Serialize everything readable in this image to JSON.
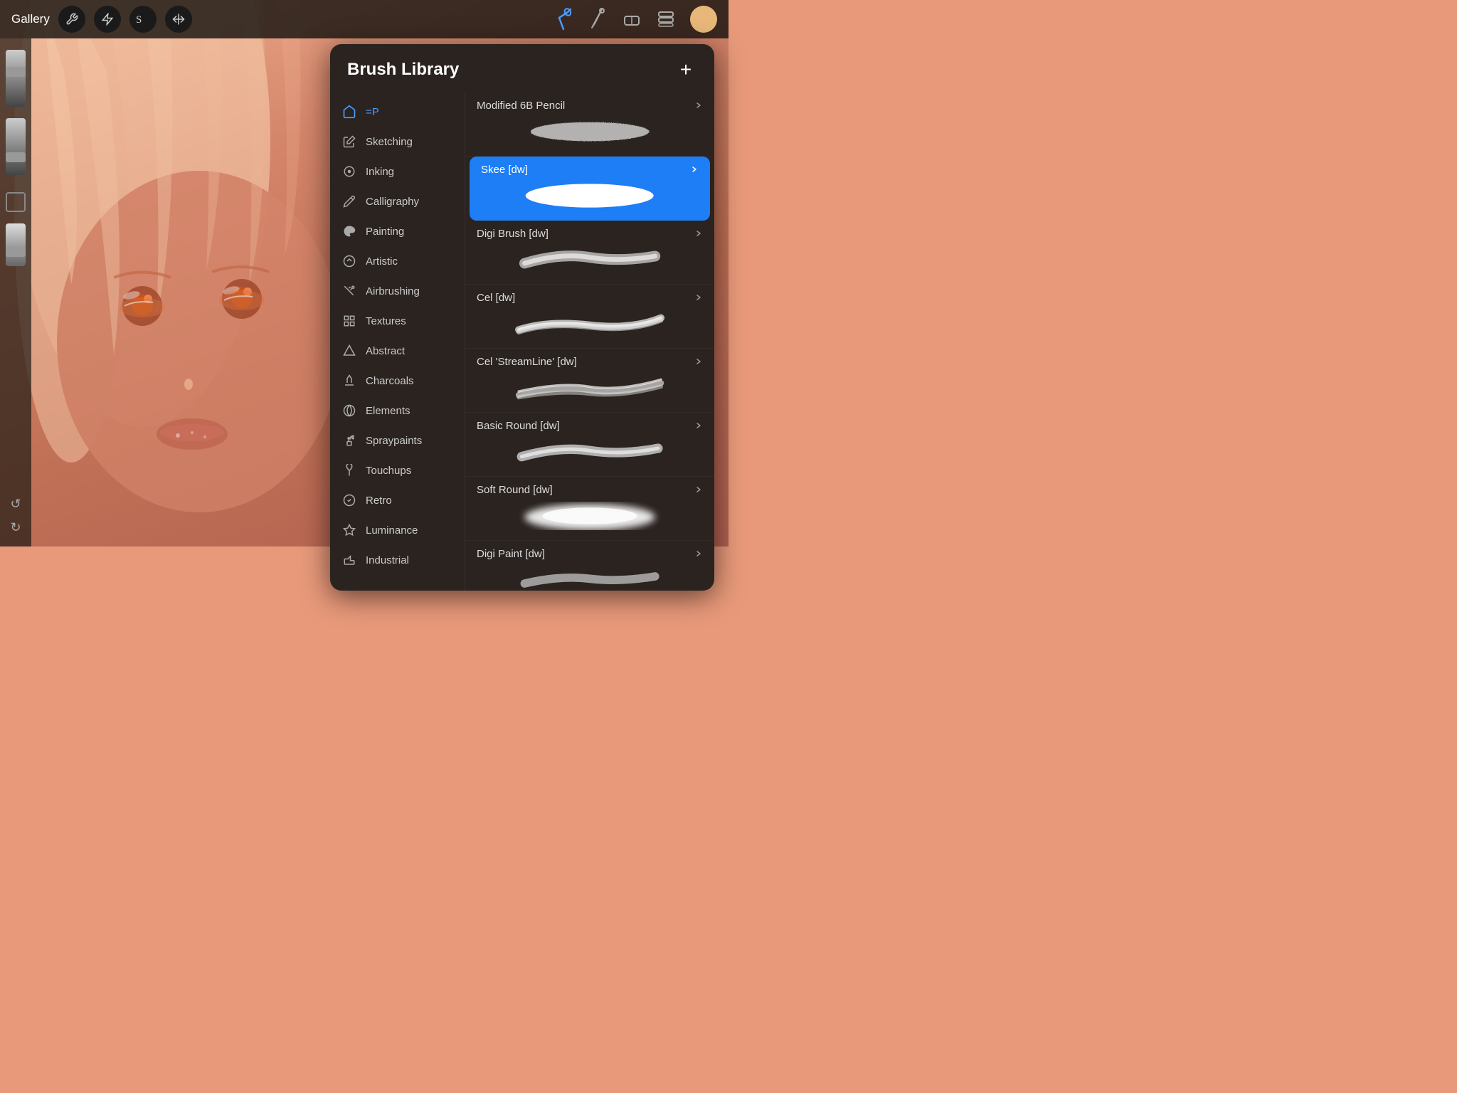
{
  "toolbar": {
    "gallery_label": "Gallery",
    "add_label": "+"
  },
  "brush_library": {
    "title": "Brush Library",
    "add_btn": "+"
  },
  "categories": [
    {
      "id": "recent",
      "label": "=P",
      "icon": "recent",
      "active": true
    },
    {
      "id": "sketching",
      "label": "Sketching",
      "icon": "pencil"
    },
    {
      "id": "inking",
      "label": "Inking",
      "icon": "ink"
    },
    {
      "id": "calligraphy",
      "label": "Calligraphy",
      "icon": "calligraphy"
    },
    {
      "id": "painting",
      "label": "Painting",
      "icon": "paint"
    },
    {
      "id": "artistic",
      "label": "Artistic",
      "icon": "artistic"
    },
    {
      "id": "airbrushing",
      "label": "Airbrushing",
      "icon": "airbrush"
    },
    {
      "id": "textures",
      "label": "Textures",
      "icon": "texture"
    },
    {
      "id": "abstract",
      "label": "Abstract",
      "icon": "abstract"
    },
    {
      "id": "charcoals",
      "label": "Charcoals",
      "icon": "charcoal"
    },
    {
      "id": "elements",
      "label": "Elements",
      "icon": "elements"
    },
    {
      "id": "spraypaints",
      "label": "Spraypaints",
      "icon": "spray"
    },
    {
      "id": "touchups",
      "label": "Touchups",
      "icon": "touchup"
    },
    {
      "id": "retro",
      "label": "Retro",
      "icon": "retro"
    },
    {
      "id": "luminance",
      "label": "Luminance",
      "icon": "luminance"
    },
    {
      "id": "industrial",
      "label": "Industrial",
      "icon": "industrial"
    }
  ],
  "brushes": [
    {
      "name": "Modified 6B Pencil",
      "selected": false,
      "type": "pencil"
    },
    {
      "name": "Skee [dw]",
      "selected": true,
      "type": "round"
    },
    {
      "name": "Digi Brush [dw]",
      "selected": false,
      "type": "digibig"
    },
    {
      "name": "Cel [dw]",
      "selected": false,
      "type": "cel"
    },
    {
      "name": "Cel 'StreamLine' [dw]",
      "selected": false,
      "type": "stream"
    },
    {
      "name": "Basic Round [dw]",
      "selected": false,
      "type": "basic"
    },
    {
      "name": "Soft Round [dw]",
      "selected": false,
      "type": "soft"
    },
    {
      "name": "Digi Paint [dw]",
      "selected": false,
      "type": "digipaint"
    }
  ]
}
